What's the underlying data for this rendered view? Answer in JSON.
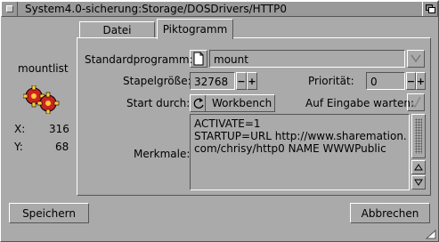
{
  "window": {
    "title": "System4.0-sicherung:Storage/DOSDrivers/HTTP0"
  },
  "tabs": [
    {
      "label": "Datei"
    },
    {
      "label": "Piktogramm"
    }
  ],
  "icon": {
    "name": "mountlist",
    "x_label": "X:",
    "x_value": "316",
    "y_label": "Y:",
    "y_value": "68"
  },
  "form": {
    "default_tool_label": "Standardprogramm:",
    "default_tool_value": "mount",
    "stack_label": "Stapelgröße:",
    "stack_value": "32768",
    "priority_label": "Priorität:",
    "priority_value": "0",
    "start_label": "Start durch:",
    "start_value": "Workbench",
    "wait_label": "Auf Eingabe warten:",
    "tooltypes_label": "Merkmale:",
    "tooltypes_lines": [
      "ACTIVATE=1",
      "STARTUP=URL http://www.sharemation.",
      "com/chrisy/http0 NAME WWWPublic"
    ]
  },
  "buttons": {
    "save": "Speichern",
    "cancel": "Abbrechen"
  },
  "colors": {
    "background": "#aaaaaa",
    "title_bar": "#999999",
    "field_bg": "#ffffff",
    "highlight": "#ffffff",
    "shadow": "#555555"
  }
}
